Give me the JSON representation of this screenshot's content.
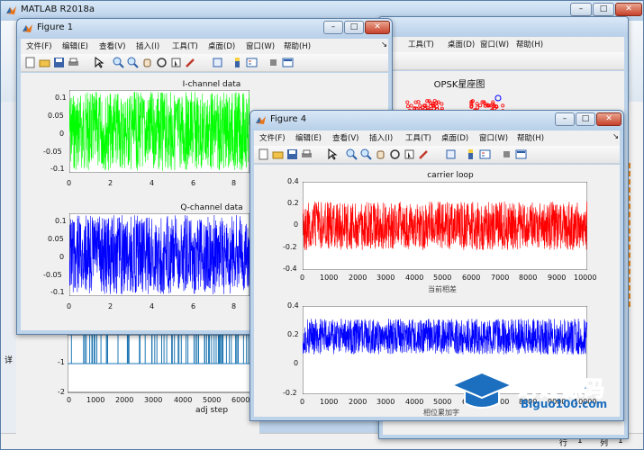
{
  "matlab": {
    "title": "MATLAB R2018a",
    "side_label": "详",
    "status": {
      "row_label": "行",
      "row_value": "1",
      "col_label": "列",
      "col_value": "1"
    },
    "bg_plot": {
      "title": "OPSK星座图",
      "xlabel": "adj step",
      "yticks": [
        "-1",
        "-2"
      ],
      "xticks": [
        "0",
        "1000",
        "2000",
        "3000",
        "4000",
        "5000",
        "6000"
      ]
    },
    "bg_menu": [
      "工具(T)",
      "桌面(D)",
      "窗口(W)",
      "帮助(H)"
    ]
  },
  "figure1": {
    "title": "Figure 1",
    "menu": [
      "文件(F)",
      "编辑(E)",
      "查看(V)",
      "插入(I)",
      "工具(T)",
      "桌面(D)",
      "窗口(W)",
      "帮助(H)"
    ],
    "plot1": {
      "title": "I-channel data",
      "yticks": [
        "0.1",
        "0.05",
        "0",
        "-0.05",
        "-0.1"
      ],
      "xticks": [
        "0",
        "2",
        "4",
        "6",
        "8"
      ],
      "color": "#00ff00"
    },
    "plot2": {
      "title": "Q-channel data",
      "yticks": [
        "0.1",
        "0.05",
        "0",
        "-0.05",
        "-0.1"
      ],
      "xticks": [
        "0",
        "2",
        "4",
        "6",
        "8"
      ],
      "color": "#0000ff"
    }
  },
  "figure4": {
    "title": "Figure 4",
    "menu": [
      "文件(F)",
      "编辑(E)",
      "查看(V)",
      "插入(I)",
      "工具(T)",
      "桌面(D)",
      "窗口(W)",
      "帮助(H)"
    ],
    "plot1": {
      "title": "carrier loop",
      "xlabel": "当前相差",
      "yticks": [
        "0.4",
        "0.2",
        "0",
        "-0.2",
        "-0.4"
      ],
      "xticks": [
        "0",
        "1000",
        "2000",
        "3000",
        "4000",
        "5000",
        "6000",
        "7000",
        "8000",
        "9000",
        "10000"
      ],
      "color": "#ff0000"
    },
    "plot2": {
      "title": "",
      "xlabel": "相位累加字",
      "yticks": [
        "0.4",
        "0.2",
        "0",
        "-0.2"
      ],
      "xticks": [
        "0",
        "1000",
        "2000",
        "3000",
        "4000",
        "5000",
        "6000",
        "7000",
        "8000",
        "9000",
        "10000"
      ],
      "color": "#0000ff"
    }
  },
  "watermark": {
    "text": "必过源码",
    "url": "Biguo100.com"
  },
  "colors": {
    "titlebar": "#c8dcf0",
    "figure_bg": "#f0f0f0",
    "accent_orange": "#f08c1e"
  }
}
